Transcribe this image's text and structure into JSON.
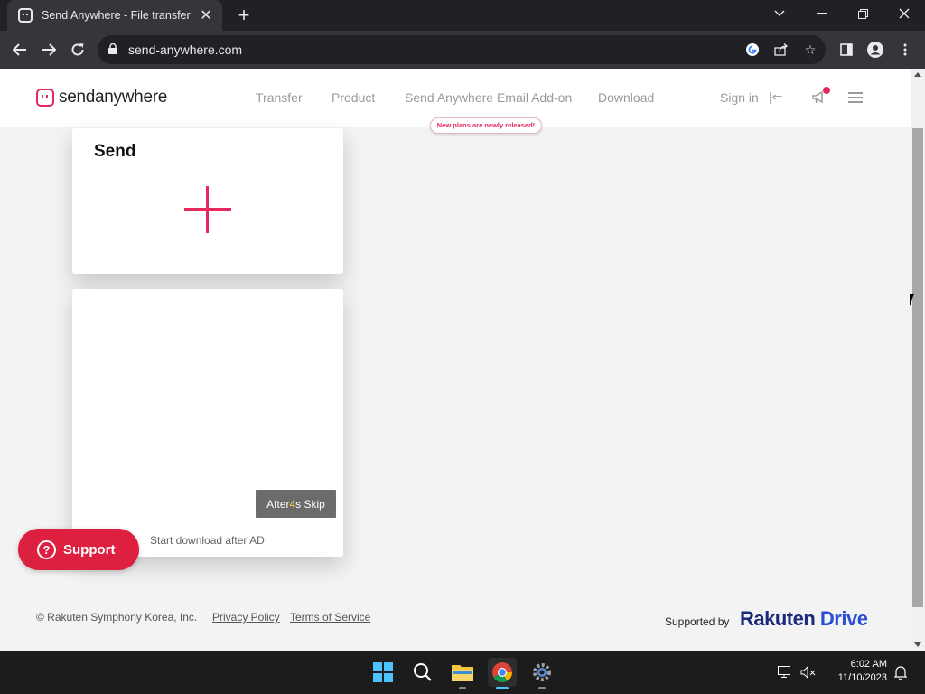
{
  "browser": {
    "tab_title": "Send Anywhere - File transfer",
    "url": "send-anywhere.com"
  },
  "site": {
    "logo_bold": "send",
    "logo_rest": "anywhere",
    "nav": [
      "Transfer",
      "Product",
      "Send Anywhere Email Add-on",
      "Download"
    ],
    "sign_in": "Sign in",
    "new_plans": "New plans are newly released!"
  },
  "send_card": {
    "title": "Send"
  },
  "ad_card": {
    "skip_prefix": "After",
    "skip_count": "4",
    "skip_suffix": "s Skip",
    "start_download": "Start download after AD"
  },
  "support": {
    "icon": "?",
    "label": "Support"
  },
  "footer": {
    "copyright": "© Rakuten Symphony Korea, Inc.",
    "privacy": "Privacy Policy",
    "terms": "Terms of Service",
    "supported_by": "Supported by",
    "brand_a": "Rakuten",
    "brand_b": "Drive"
  },
  "taskbar": {
    "time": "6:02 AM",
    "date": "11/10/2023"
  },
  "colors": {
    "brand": "#e6295d",
    "support": "#dd1f40"
  }
}
